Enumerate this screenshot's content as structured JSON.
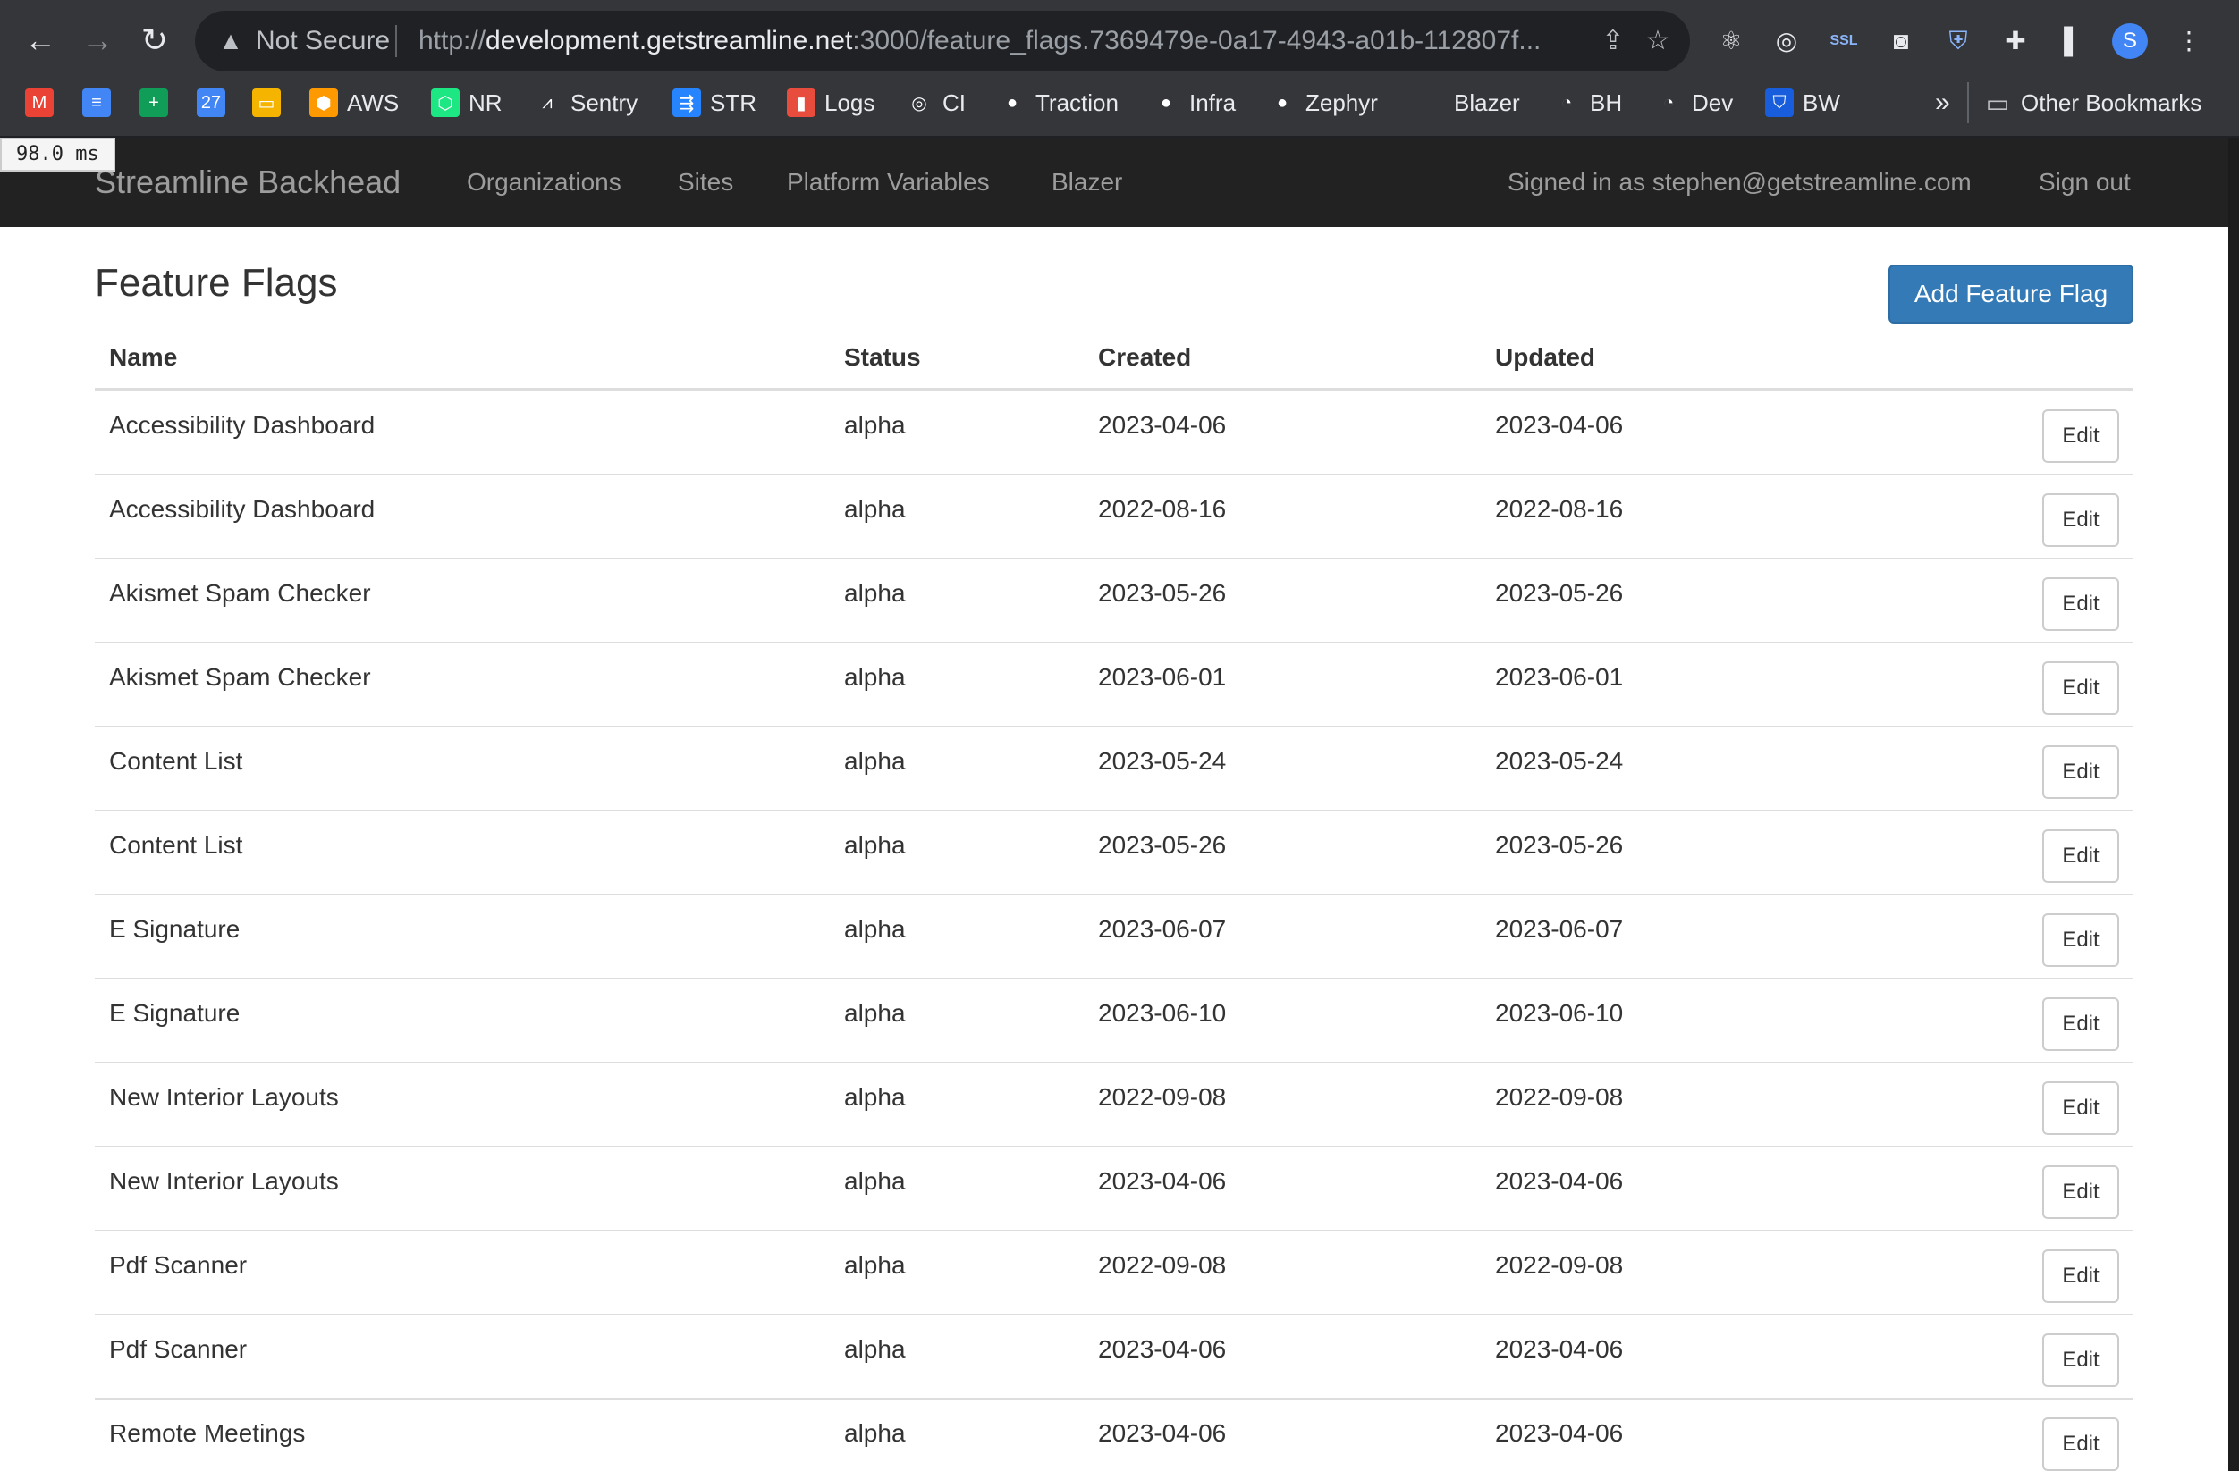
{
  "browser": {
    "security_label": "Not Secure",
    "url_prefix": "http://",
    "url_host": "development.getstreamline.net",
    "url_rest": ":3000/feature_flags.7369479e-0a17-4943-a01b-112807f...",
    "profile_initial": "S",
    "bookmarks": [
      {
        "label": "",
        "icon": "gmail-icon",
        "color": "#ea4335",
        "glyph": "M"
      },
      {
        "label": "",
        "icon": "docs-icon",
        "color": "#4285f4",
        "glyph": "≡"
      },
      {
        "label": "",
        "icon": "sheets-icon",
        "color": "#0f9d58",
        "glyph": "+"
      },
      {
        "label": "",
        "icon": "calendar-icon",
        "color": "#4285f4",
        "glyph": "27"
      },
      {
        "label": "",
        "icon": "slides-icon",
        "color": "#f4b400",
        "glyph": "▭"
      },
      {
        "label": "AWS",
        "icon": "aws-icon",
        "color": "#ff9900",
        "glyph": "⬢"
      },
      {
        "label": "NR",
        "icon": "newrelic-icon",
        "color": "#1ce783",
        "glyph": "⬡"
      },
      {
        "label": "Sentry",
        "icon": "sentry-icon",
        "color": "#35363a",
        "glyph": "⩘"
      },
      {
        "label": "STR",
        "icon": "str-icon",
        "color": "#2684ff",
        "glyph": "⇶"
      },
      {
        "label": "Logs",
        "icon": "logs-icon",
        "color": "#e74c3c",
        "glyph": "▮"
      },
      {
        "label": "CI",
        "icon": "ci-icon",
        "color": "#35363a",
        "glyph": "◎"
      },
      {
        "label": "Traction",
        "icon": "github-icon",
        "color": "#35363a",
        "glyph": "●"
      },
      {
        "label": "Infra",
        "icon": "github-icon",
        "color": "#35363a",
        "glyph": "●"
      },
      {
        "label": "Zephyr",
        "icon": "github-icon",
        "color": "#35363a",
        "glyph": "●"
      },
      {
        "label": "Blazer",
        "icon": "blazer-icon",
        "color": "#35363a",
        "glyph": ""
      },
      {
        "label": "BH",
        "icon": "bh-icon",
        "color": "#35363a",
        "glyph": "◔"
      },
      {
        "label": "Dev",
        "icon": "dev-icon",
        "color": "#35363a",
        "glyph": "◔"
      },
      {
        "label": "BW",
        "icon": "bitwarden-icon",
        "color": "#175ddc",
        "glyph": "⛉"
      }
    ],
    "more_bookmarks": "»",
    "other_bookmarks": "Other Bookmarks"
  },
  "perf_badge": "98.0 ms",
  "navbar": {
    "brand": "Streamline Backhead",
    "links": [
      "Organizations",
      "Sites",
      "Platform Variables",
      "Blazer"
    ],
    "signed_in": "Signed in as stephen@getstreamline.com",
    "sign_out": "Sign out"
  },
  "page": {
    "title": "Feature Flags",
    "add_button": "Add Feature Flag",
    "edit_label": "Edit",
    "columns": [
      "Name",
      "Status",
      "Created",
      "Updated"
    ],
    "rows": [
      {
        "name": "Accessibility Dashboard",
        "status": "alpha",
        "created": "2023-04-06",
        "updated": "2023-04-06"
      },
      {
        "name": "Accessibility Dashboard",
        "status": "alpha",
        "created": "2022-08-16",
        "updated": "2022-08-16"
      },
      {
        "name": "Akismet Spam Checker",
        "status": "alpha",
        "created": "2023-05-26",
        "updated": "2023-05-26"
      },
      {
        "name": "Akismet Spam Checker",
        "status": "alpha",
        "created": "2023-06-01",
        "updated": "2023-06-01"
      },
      {
        "name": "Content List",
        "status": "alpha",
        "created": "2023-05-24",
        "updated": "2023-05-24"
      },
      {
        "name": "Content List",
        "status": "alpha",
        "created": "2023-05-26",
        "updated": "2023-05-26"
      },
      {
        "name": "E Signature",
        "status": "alpha",
        "created": "2023-06-07",
        "updated": "2023-06-07"
      },
      {
        "name": "E Signature",
        "status": "alpha",
        "created": "2023-06-10",
        "updated": "2023-06-10"
      },
      {
        "name": "New Interior Layouts",
        "status": "alpha",
        "created": "2022-09-08",
        "updated": "2022-09-08"
      },
      {
        "name": "New Interior Layouts",
        "status": "alpha",
        "created": "2023-04-06",
        "updated": "2023-04-06"
      },
      {
        "name": "Pdf Scanner",
        "status": "alpha",
        "created": "2022-09-08",
        "updated": "2022-09-08"
      },
      {
        "name": "Pdf Scanner",
        "status": "alpha",
        "created": "2023-04-06",
        "updated": "2023-04-06"
      },
      {
        "name": "Remote Meetings",
        "status": "alpha",
        "created": "2023-04-06",
        "updated": "2023-04-06"
      }
    ]
  }
}
